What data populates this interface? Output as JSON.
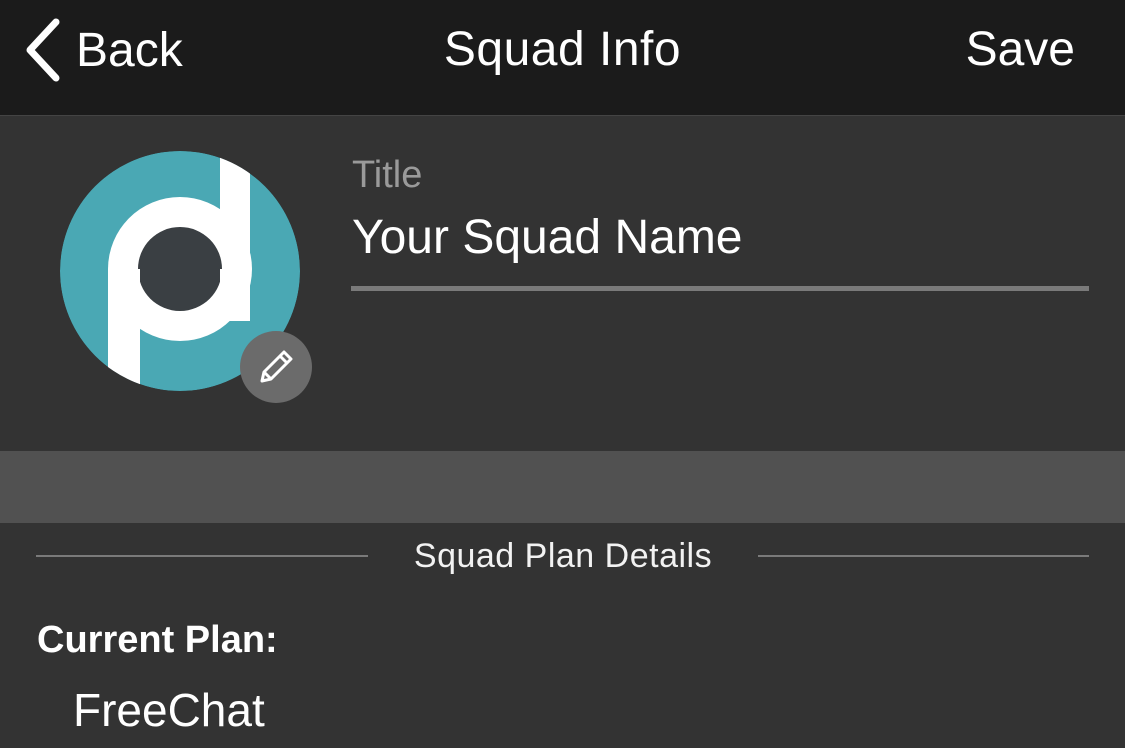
{
  "nav": {
    "back_label": "Back",
    "title": "Squad Info",
    "save_label": "Save"
  },
  "profile": {
    "avatar_icon": "squad-logo",
    "edit_icon": "pencil-icon",
    "title_label": "Title",
    "title_value": "Your Squad Name"
  },
  "plan": {
    "section_heading": "Squad Plan Details",
    "current_plan_label": "Current Plan:",
    "current_plan_value": "FreeChat"
  },
  "colors": {
    "nav_bg": "#1b1b1b",
    "page_bg": "#333333",
    "band_bg": "#515151",
    "logo_teal": "#4aa8b4",
    "logo_dark": "#3a3f43"
  }
}
